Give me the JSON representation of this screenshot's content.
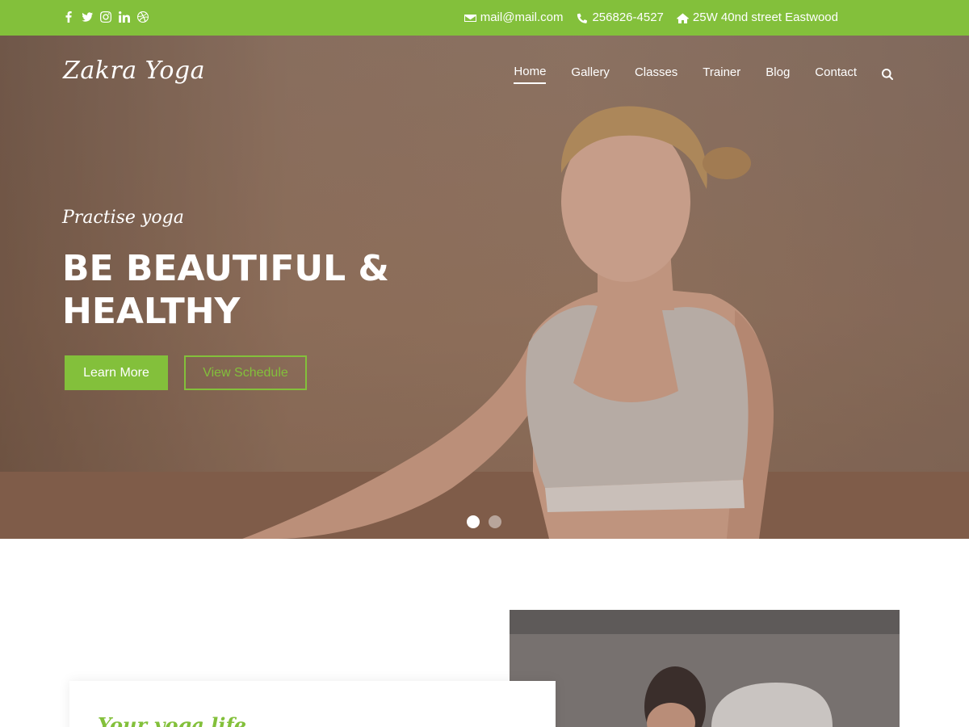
{
  "topbar": {
    "social_icons": [
      "facebook-icon",
      "twitter-icon",
      "instagram-icon",
      "linkedin-icon",
      "dribbble-icon"
    ],
    "email": "mail@mail.com",
    "phone": "256826-4527",
    "address": "25W 40nd street Eastwood"
  },
  "header": {
    "logo": "Zakra Yoga",
    "nav": [
      "Home",
      "Gallery",
      "Classes",
      "Trainer",
      "Blog",
      "Contact"
    ],
    "active_nav": "Home"
  },
  "hero": {
    "kicker": "Practise yoga",
    "headline": "BE BEAUTIFUL & HEALTHY",
    "primary_button": "Learn More",
    "secondary_button": "View Schedule",
    "slide_count": 2,
    "active_slide": 1
  },
  "about": {
    "title": "Your yoga life"
  },
  "colors": {
    "accent": "#83c03b",
    "white": "#ffffff"
  }
}
